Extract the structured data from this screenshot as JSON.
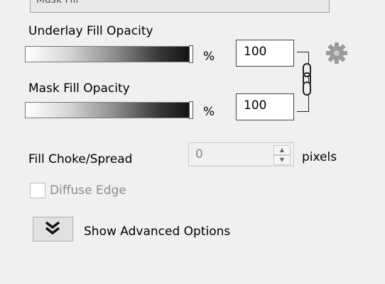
{
  "top_field": {
    "text": "Mask Fill"
  },
  "underlay": {
    "label": "Underlay Fill Opacity",
    "unit": "%",
    "value": "100",
    "slider_fraction": 1.0
  },
  "mask": {
    "label": "Mask Fill Opacity",
    "unit": "%",
    "value": "100",
    "slider_fraction": 1.0
  },
  "icons": {
    "link": "chain-link-icon",
    "settings": "gear-icon",
    "expand": "double-chevron-down-icon"
  },
  "choke": {
    "label": "Fill Choke/Spread",
    "value": "0",
    "unit": "pixels"
  },
  "diffuse_edge": {
    "label": "Diffuse Edge",
    "checked": false,
    "enabled": false
  },
  "advanced": {
    "label": "Show Advanced Options"
  },
  "colors": {
    "background": "#f0f0f0",
    "disabled_text": "#8d8d8d",
    "gear": "#9a9a9a"
  }
}
